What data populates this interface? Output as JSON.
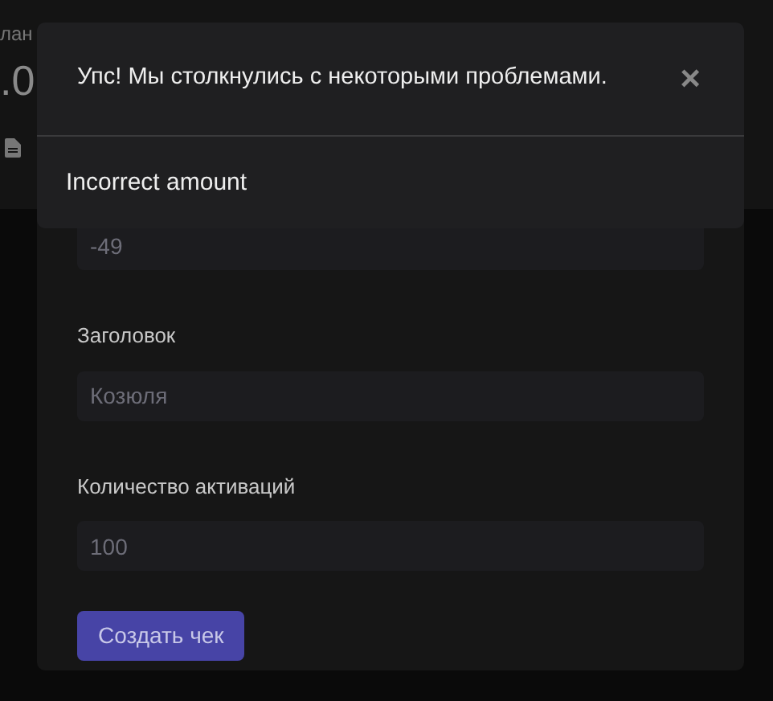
{
  "background": {
    "label_fragment": "лан",
    "amount_fragment": ".0"
  },
  "form": {
    "fields": [
      {
        "placeholder": "-49"
      },
      {
        "label": "Заголовок",
        "placeholder": "Козюля"
      },
      {
        "label": "Количество активаций",
        "placeholder": "100"
      }
    ],
    "submit": "Создать чек"
  },
  "alert": {
    "title": "Упс! Мы столкнулись с некоторыми проблемами.",
    "close": "×",
    "message": "Incorrect amount"
  }
}
